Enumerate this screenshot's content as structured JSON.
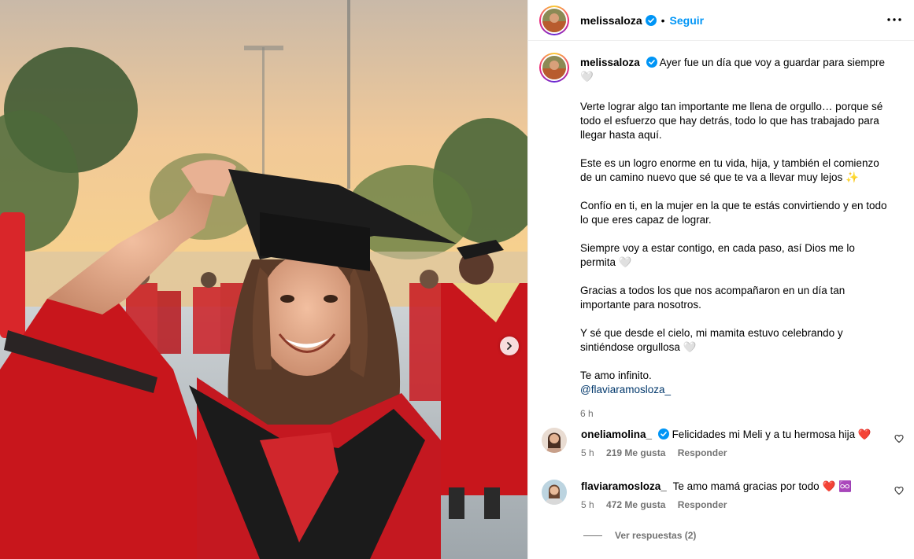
{
  "post": {
    "username": "melissaloza",
    "follow_label": "Seguir",
    "dot": "•"
  },
  "caption": {
    "username": "melissaloza",
    "first": "Ayer fue un día que voy a guardar para siempre",
    "p2": "Verte lograr algo tan importante me llena de orgullo… porque sé todo el esfuerzo que hay detrás, todo lo que has trabajado para llegar hasta aquí.",
    "p3": "Este es un logro enorme en tu vida, hija, y también el comienzo de un camino nuevo que sé que te va a llevar muy lejos",
    "p4": "Confío en ti, en la mujer en la que te estás convirtiendo y en todo lo que eres capaz de lograr.",
    "p5": "Siempre voy a estar contigo, en cada paso, así Dios me lo permita",
    "p6": "Gracias a todos los que nos acompañaron en un día tan importante para nosotros.",
    "p7": "Y sé que desde el cielo, mi mamita estuvo celebrando y sintiéndose orgullosa",
    "p8": "Te amo infinito.",
    "mention": "@flaviaramosloza_",
    "time": "6 h",
    "emoji_heart": "🤍",
    "emoji_sparkles": "✨"
  },
  "comments": [
    {
      "username": "oneliamolina_",
      "text": "Felicidades mi Meli y a tu hermosa hija",
      "emoji": "❤️",
      "time": "5 h",
      "likes": "219 Me gusta",
      "reply": "Responder"
    },
    {
      "username": "flaviaramosloza_",
      "text": "Te amo mamá gracias por todo",
      "emoji": "❤️ ♾️",
      "time": "5 h",
      "likes": "472 Me gusta",
      "reply": "Responder"
    }
  ],
  "view_replies": "Ver respuestas (2)",
  "icons": {
    "verified": "verified-badge-icon",
    "more": "more-options-icon",
    "next": "chevron-right-icon",
    "like": "heart-outline-icon"
  },
  "colors": {
    "accent": "#0095f6",
    "verified": "#0095f6",
    "mention": "#00376b",
    "muted": "#737373",
    "gown_red": "#c8161c"
  }
}
